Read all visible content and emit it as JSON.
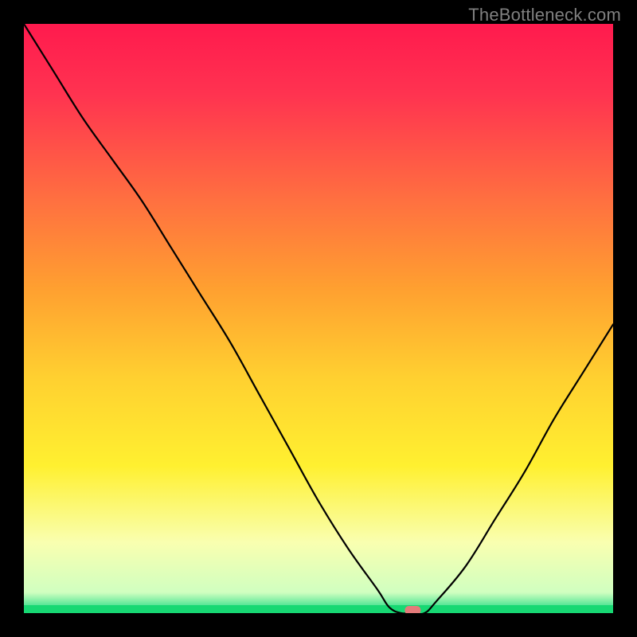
{
  "attribution": "TheBottleneck.com",
  "chart_data": {
    "type": "line",
    "title": "",
    "xlabel": "",
    "ylabel": "",
    "xlim": [
      0,
      100
    ],
    "ylim": [
      0,
      100
    ],
    "x": [
      0,
      5,
      10,
      15,
      20,
      25,
      30,
      35,
      40,
      45,
      50,
      55,
      60,
      62,
      64,
      66,
      68,
      70,
      75,
      80,
      85,
      90,
      95,
      100
    ],
    "values": [
      100,
      92,
      84,
      77,
      70,
      62,
      54,
      46,
      37,
      28,
      19,
      11,
      4,
      1,
      0,
      0,
      0,
      2,
      8,
      16,
      24,
      33,
      41,
      49
    ],
    "marker": {
      "x": 66,
      "y": 0
    },
    "gradient_stops": [
      {
        "offset": 0.0,
        "color": "#ff1a4e"
      },
      {
        "offset": 0.12,
        "color": "#ff3350"
      },
      {
        "offset": 0.3,
        "color": "#ff7040"
      },
      {
        "offset": 0.45,
        "color": "#ffa030"
      },
      {
        "offset": 0.6,
        "color": "#ffd030"
      },
      {
        "offset": 0.75,
        "color": "#fff030"
      },
      {
        "offset": 0.88,
        "color": "#f9ffb0"
      },
      {
        "offset": 0.965,
        "color": "#d0ffc0"
      },
      {
        "offset": 0.985,
        "color": "#60e89a"
      },
      {
        "offset": 1.0,
        "color": "#17d873"
      }
    ]
  }
}
